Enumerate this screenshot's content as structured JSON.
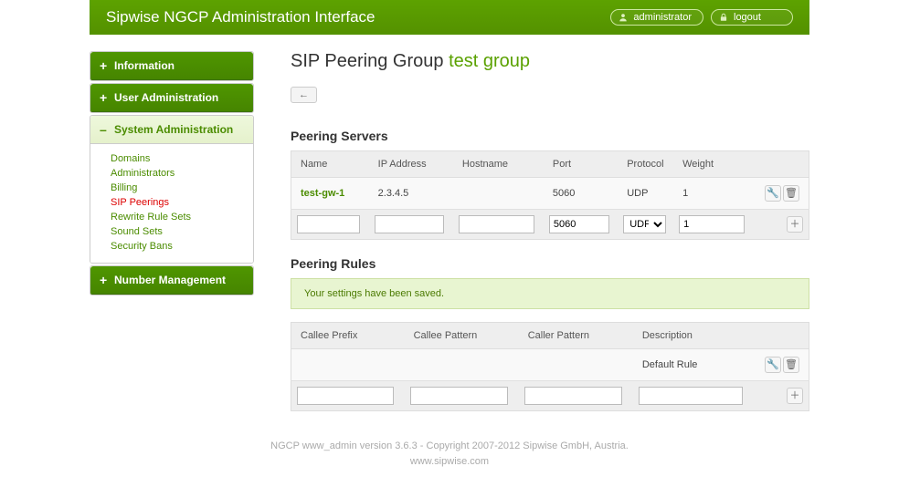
{
  "header": {
    "title": "Sipwise NGCP Administration Interface",
    "user_label": "administrator",
    "logout_label": "logout"
  },
  "sidebar": {
    "sections": [
      {
        "label": "Information",
        "open": false,
        "items": []
      },
      {
        "label": "User Administration",
        "open": false,
        "items": []
      },
      {
        "label": "System Administration",
        "open": true,
        "items": [
          {
            "label": "Domains",
            "active": false
          },
          {
            "label": "Administrators",
            "active": false
          },
          {
            "label": "Billing",
            "active": false
          },
          {
            "label": "SIP Peerings",
            "active": true
          },
          {
            "label": "Rewrite Rule Sets",
            "active": false
          },
          {
            "label": "Sound Sets",
            "active": false
          },
          {
            "label": "Security Bans",
            "active": false
          }
        ]
      },
      {
        "label": "Number Management",
        "open": false,
        "items": []
      }
    ]
  },
  "page": {
    "title_prefix": "SIP Peering Group ",
    "group_name": "test group",
    "back_label": "←"
  },
  "servers": {
    "heading": "Peering Servers",
    "columns": [
      "Name",
      "IP Address",
      "Hostname",
      "Port",
      "Protocol",
      "Weight"
    ],
    "rows": [
      {
        "name": "test-gw-1",
        "ip": "2.3.4.5",
        "hostname": "",
        "port": "5060",
        "protocol": "UDP",
        "weight": "1"
      }
    ],
    "form": {
      "name": "",
      "ip": "",
      "hostname": "",
      "port": "5060",
      "protocol_selected": "UDP",
      "protocol_options": [
        "UDP"
      ],
      "weight": "1"
    }
  },
  "rules": {
    "heading": "Peering Rules",
    "notice": "Your settings have been saved.",
    "columns": [
      "Callee Prefix",
      "Callee Pattern",
      "Caller Pattern",
      "Description"
    ],
    "rows": [
      {
        "callee_prefix": "",
        "callee_pattern": "",
        "caller_pattern": "",
        "description": "Default Rule"
      }
    ],
    "form": {
      "callee_prefix": "",
      "callee_pattern": "",
      "caller_pattern": "",
      "description": ""
    }
  },
  "footer": {
    "line1": "NGCP www_admin version 3.6.3 - Copyright 2007-2012 Sipwise GmbH, Austria.",
    "line2": "www.sipwise.com"
  },
  "icons": {
    "edit": "🔧",
    "delete": "🗑",
    "add": "＋",
    "user": "👤",
    "lock": "🔒"
  }
}
